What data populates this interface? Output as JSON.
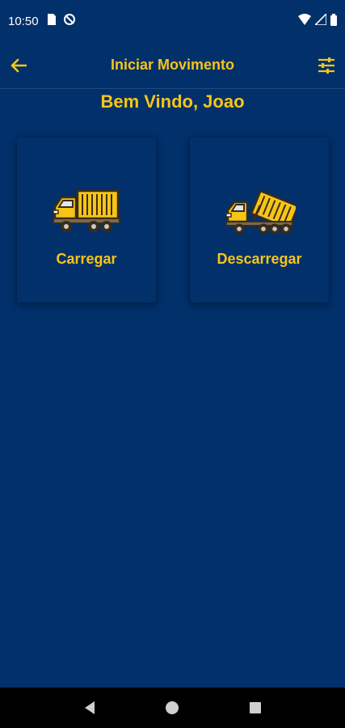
{
  "status_bar": {
    "time": "10:50",
    "icons": [
      "sim-card-icon",
      "no-sync-icon",
      "wifi-icon",
      "signal-icon",
      "battery-icon"
    ]
  },
  "app_bar": {
    "title": "Iniciar Movimento",
    "back_icon": "arrow-left-icon",
    "settings_icon": "sliders-icon"
  },
  "welcome": "Bem Vindo, Joao",
  "cards": [
    {
      "label": "Carregar",
      "icon": "cargo-truck-icon"
    },
    {
      "label": "Descarregar",
      "icon": "dump-truck-icon"
    }
  ],
  "nav_bar": {
    "icons": [
      "back-triangle-icon",
      "home-circle-icon",
      "recents-square-icon"
    ]
  },
  "colors": {
    "background": "#02306a",
    "accent": "#f5c518",
    "nav_background": "#000000"
  }
}
